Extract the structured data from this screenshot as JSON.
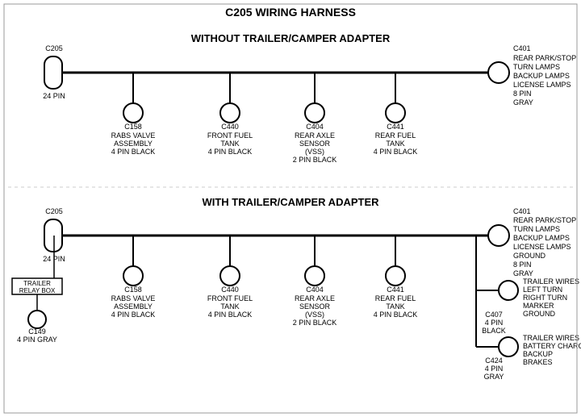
{
  "title": "C205 WIRING HARNESS",
  "section1": {
    "label": "WITHOUT TRAILER/CAMPER ADAPTER",
    "left_connector": {
      "name": "C205",
      "pin_label": "24 PIN"
    },
    "right_connector": {
      "name": "C401",
      "pin_label": "8 PIN",
      "color": "GRAY",
      "desc": [
        "REAR PARK/STOP",
        "TURN LAMPS",
        "BACKUP LAMPS",
        "LICENSE LAMPS"
      ]
    },
    "connectors": [
      {
        "name": "C158",
        "desc": [
          "RABS VALVE",
          "ASSEMBLY",
          "4 PIN BLACK"
        ]
      },
      {
        "name": "C440",
        "desc": [
          "FRONT FUEL",
          "TANK",
          "4 PIN BLACK"
        ]
      },
      {
        "name": "C404",
        "desc": [
          "REAR AXLE",
          "SENSOR",
          "(VSS)",
          "2 PIN BLACK"
        ]
      },
      {
        "name": "C441",
        "desc": [
          "REAR FUEL",
          "TANK",
          "4 PIN BLACK"
        ]
      }
    ]
  },
  "section2": {
    "label": "WITH TRAILER/CAMPER ADAPTER",
    "left_connector": {
      "name": "C205",
      "pin_label": "24 PIN"
    },
    "right_connector": {
      "name": "C401",
      "pin_label": "8 PIN",
      "color": "GRAY",
      "desc": [
        "REAR PARK/STOP",
        "TURN LAMPS",
        "BACKUP LAMPS",
        "LICENSE LAMPS",
        "GROUND"
      ]
    },
    "extra_left": {
      "box": "TRAILER RELAY BOX",
      "connector": "C149",
      "pin_label": "4 PIN GRAY"
    },
    "connectors": [
      {
        "name": "C158",
        "desc": [
          "RABS VALVE",
          "ASSEMBLY",
          "4 PIN BLACK"
        ]
      },
      {
        "name": "C440",
        "desc": [
          "FRONT FUEL",
          "TANK",
          "4 PIN BLACK"
        ]
      },
      {
        "name": "C404",
        "desc": [
          "REAR AXLE",
          "SENSOR",
          "(VSS)",
          "2 PIN BLACK"
        ]
      },
      {
        "name": "C441",
        "desc": [
          "REAR FUEL",
          "TANK",
          "4 PIN BLACK"
        ]
      }
    ],
    "extra_right": [
      {
        "name": "C407",
        "pin_label": "4 PIN",
        "color": "BLACK",
        "desc": [
          "TRAILER WIRES",
          "LEFT TURN",
          "RIGHT TURN",
          "MARKER",
          "GROUND"
        ]
      },
      {
        "name": "C424",
        "pin_label": "4 PIN",
        "color": "GRAY",
        "desc": [
          "TRAILER WIRES",
          "BATTERY CHARGE",
          "BACKUP",
          "BRAKES"
        ]
      }
    ]
  }
}
